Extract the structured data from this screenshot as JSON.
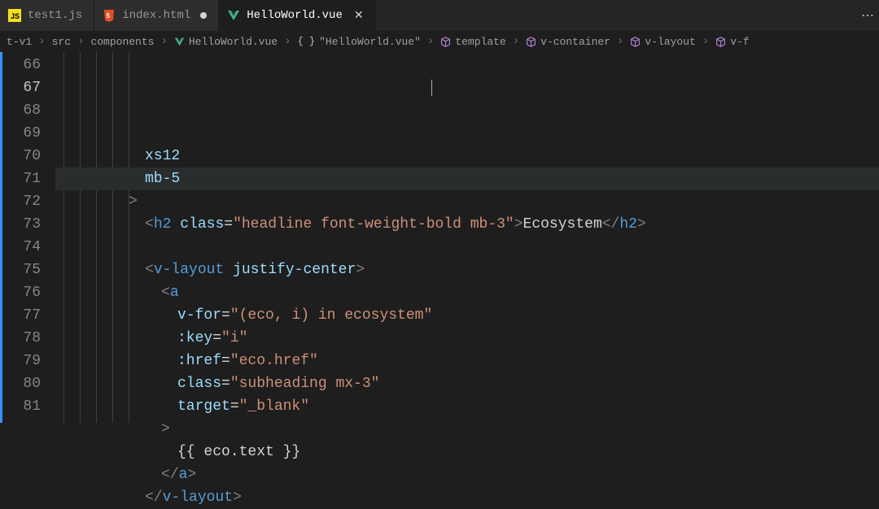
{
  "tabs": [
    {
      "label": "test1.js",
      "icon": "js"
    },
    {
      "label": "index.html",
      "icon": "html",
      "dirty": true
    },
    {
      "label": "HelloWorld.vue",
      "icon": "vue",
      "active": true,
      "close": true
    }
  ],
  "breadcrumbs": {
    "parts": [
      {
        "label": "t-v1"
      },
      {
        "label": "src"
      },
      {
        "label": "components"
      },
      {
        "label": "HelloWorld.vue",
        "icon": "vue"
      },
      {
        "label": "\"HelloWorld.vue\"",
        "icon": "braces"
      },
      {
        "label": "template",
        "icon": "cube"
      },
      {
        "label": "v-container",
        "icon": "cube"
      },
      {
        "label": "v-layout",
        "icon": "cube"
      },
      {
        "label": "v-f",
        "icon": "cube"
      }
    ]
  },
  "editor": {
    "lineNumbers": [
      "66",
      "67",
      "68",
      "69",
      "70",
      "71",
      "72",
      "73",
      "74",
      "75",
      "76",
      "77",
      "78",
      "79",
      "80",
      "81"
    ],
    "highlightLine": 1,
    "lines": [
      {
        "indent": 10,
        "tokens": [
          {
            "c": "attr",
            "t": "xs12"
          }
        ]
      },
      {
        "indent": 10,
        "tokens": [
          {
            "c": "attr",
            "t": "mb-5"
          }
        ]
      },
      {
        "indent": 8,
        "tokens": [
          {
            "c": "punc",
            "t": ">"
          }
        ]
      },
      {
        "indent": 10,
        "tokens": [
          {
            "c": "punc",
            "t": "<"
          },
          {
            "c": "tag",
            "t": "h2"
          },
          {
            "c": "txt",
            "t": " "
          },
          {
            "c": "attr",
            "t": "class"
          },
          {
            "c": "txt",
            "t": "="
          },
          {
            "c": "str",
            "t": "\"headline font-weight-bold mb-3\""
          },
          {
            "c": "punc",
            "t": ">"
          },
          {
            "c": "txt",
            "t": "Ecosystem"
          },
          {
            "c": "punc",
            "t": "</"
          },
          {
            "c": "tag",
            "t": "h2"
          },
          {
            "c": "punc",
            "t": ">"
          }
        ]
      },
      {
        "indent": 0,
        "tokens": []
      },
      {
        "indent": 10,
        "tokens": [
          {
            "c": "punc",
            "t": "<"
          },
          {
            "c": "tag",
            "t": "v-layout"
          },
          {
            "c": "txt",
            "t": " "
          },
          {
            "c": "attr",
            "t": "justify-center"
          },
          {
            "c": "punc",
            "t": ">"
          }
        ]
      },
      {
        "indent": 12,
        "tokens": [
          {
            "c": "punc",
            "t": "<"
          },
          {
            "c": "tag",
            "t": "a"
          }
        ]
      },
      {
        "indent": 14,
        "tokens": [
          {
            "c": "attr",
            "t": "v-for"
          },
          {
            "c": "txt",
            "t": "="
          },
          {
            "c": "str",
            "t": "\"(eco, i) in ecosystem\""
          }
        ]
      },
      {
        "indent": 14,
        "tokens": [
          {
            "c": "attr",
            "t": ":key"
          },
          {
            "c": "txt",
            "t": "="
          },
          {
            "c": "str",
            "t": "\"i\""
          }
        ]
      },
      {
        "indent": 14,
        "tokens": [
          {
            "c": "attr",
            "t": ":href"
          },
          {
            "c": "txt",
            "t": "="
          },
          {
            "c": "str",
            "t": "\"eco.href\""
          }
        ]
      },
      {
        "indent": 14,
        "tokens": [
          {
            "c": "attr",
            "t": "class"
          },
          {
            "c": "txt",
            "t": "="
          },
          {
            "c": "str",
            "t": "\"subheading mx-3\""
          }
        ]
      },
      {
        "indent": 14,
        "tokens": [
          {
            "c": "attr",
            "t": "target"
          },
          {
            "c": "txt",
            "t": "="
          },
          {
            "c": "str",
            "t": "\"_blank\""
          }
        ]
      },
      {
        "indent": 12,
        "tokens": [
          {
            "c": "punc",
            "t": ">"
          }
        ]
      },
      {
        "indent": 14,
        "tokens": [
          {
            "c": "must",
            "t": "{{ eco.text }}"
          }
        ]
      },
      {
        "indent": 12,
        "tokens": [
          {
            "c": "punc",
            "t": "</"
          },
          {
            "c": "tag",
            "t": "a"
          },
          {
            "c": "punc",
            "t": ">"
          }
        ]
      },
      {
        "indent": 10,
        "tokens": [
          {
            "c": "punc",
            "t": "</"
          },
          {
            "c": "tag",
            "t": "v-layout"
          },
          {
            "c": "punc",
            "t": ">"
          }
        ]
      }
    ]
  }
}
